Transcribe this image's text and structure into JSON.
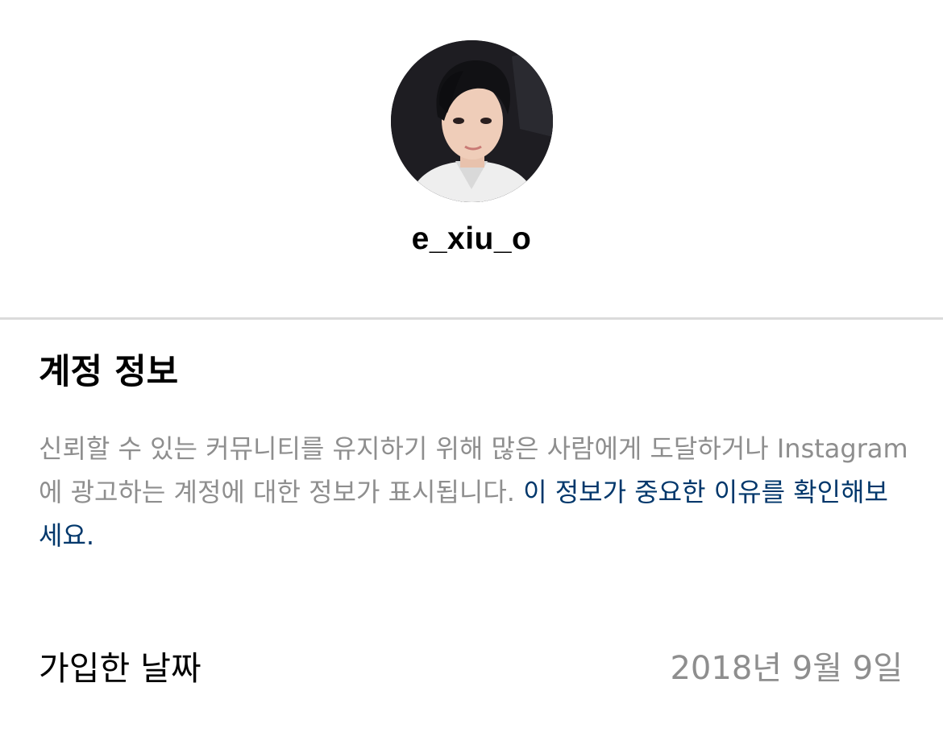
{
  "profile": {
    "username": "e_xiu_o",
    "avatar_alt": "profile-photo"
  },
  "account_info": {
    "title": "계정 정보",
    "description": "신뢰할 수 있는 커뮤니티를 유지하기 위해 많은 사람에게 도달하거나 Instagram에 광고하는 계정에 대한 정보가 표시됩니다. ",
    "link_text": "이 정보가 중요한 이유를 확인해보세요."
  },
  "date_joined": {
    "label": "가입한 날짜",
    "value": "2018년 9월 9일"
  },
  "colors": {
    "link": "#00376b",
    "secondary_text": "#8e8e8e",
    "divider": "#dbdbdb"
  }
}
